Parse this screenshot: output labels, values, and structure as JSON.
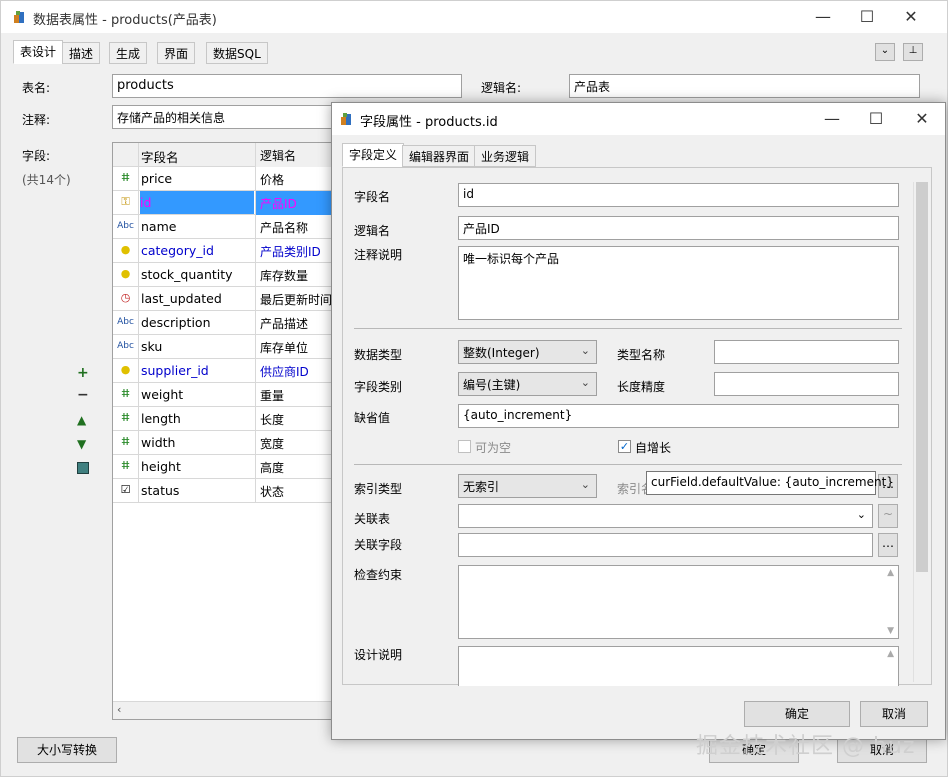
{
  "main_window": {
    "title": "数据表属性 - products(产品表)",
    "tabs": [
      "表设计",
      "描述",
      "生成",
      "界面",
      "数据SQL"
    ],
    "table_name_label": "表名:",
    "table_name_value": "products",
    "logic_name_label": "逻辑名:",
    "logic_name_value": "产品表",
    "comment_label": "注释:",
    "comment_value": "存储产品的相关信息",
    "fields_label": "字段:",
    "fields_count": "(共14个)",
    "grid_headers": {
      "name": "字段名",
      "logic": "逻辑名"
    },
    "rows": [
      {
        "icon": "number-icon",
        "name": "price",
        "logic": "价格",
        "color": "#000000"
      },
      {
        "icon": "key-icon",
        "name": "id",
        "logic": "产品ID",
        "color": "#ff00ff",
        "selected": true
      },
      {
        "icon": "text-icon",
        "name": "name",
        "logic": "产品名称",
        "color": "#000000"
      },
      {
        "icon": "bulb-icon",
        "name": "category_id",
        "logic": "产品类别ID",
        "color": "#0000cc"
      },
      {
        "icon": "bulb-icon",
        "name": "stock_quantity",
        "logic": "库存数量",
        "color": "#000000"
      },
      {
        "icon": "clock-icon",
        "name": "last_updated",
        "logic": "最后更新时间",
        "color": "#000000"
      },
      {
        "icon": "text-icon",
        "name": "description",
        "logic": "产品描述",
        "color": "#000000"
      },
      {
        "icon": "text-icon",
        "name": "sku",
        "logic": "库存单位",
        "color": "#000000"
      },
      {
        "icon": "bulb-icon",
        "name": "supplier_id",
        "logic": "供应商ID",
        "color": "#0000cc"
      },
      {
        "icon": "number-icon",
        "name": "weight",
        "logic": "重量",
        "color": "#000000"
      },
      {
        "icon": "number-icon",
        "name": "length",
        "logic": "长度",
        "color": "#000000"
      },
      {
        "icon": "number-icon",
        "name": "width",
        "logic": "宽度",
        "color": "#000000"
      },
      {
        "icon": "number-icon",
        "name": "height",
        "logic": "高度",
        "color": "#000000"
      },
      {
        "icon": "checkbox-icon",
        "name": "status",
        "logic": "状态",
        "color": "#000000"
      }
    ],
    "case_button": "大小写转换",
    "bottom_cancel_button": "取消",
    "bottom_ok_button": "确定"
  },
  "dialog": {
    "title": "字段属性 - products.id",
    "tabs": [
      "字段定义",
      "编辑器界面",
      "业务逻辑"
    ],
    "field_name_label": "字段名",
    "field_name_value": "id",
    "logic_name_label": "逻辑名",
    "logic_name_value": "产品ID",
    "comment_label": "注释说明",
    "comment_value": "唯一标识每个产品",
    "data_type_label": "数据类型",
    "data_type_value": "整数(Integer)",
    "type_name_label": "类型名称",
    "type_name_value": "",
    "field_category_label": "字段类别",
    "field_category_value": "编号(主键)",
    "length_label": "长度精度",
    "length_value": "",
    "default_label": "缺省值",
    "default_value": "{auto_increment}",
    "nullable_label": "可为空",
    "autoinc_label": "自增长",
    "index_type_label": "索引类型",
    "index_type_value": "无索引",
    "index_name_label": "索引名",
    "related_table_label": "关联表",
    "related_field_label": "关联字段",
    "check_label": "检查约束",
    "design_label": "设计说明",
    "ok_button": "确定",
    "cancel_button": "取消",
    "tooltip": "curField.defaultValue: {auto_increment}"
  },
  "watermark": "掘金技术社区 @ huz"
}
